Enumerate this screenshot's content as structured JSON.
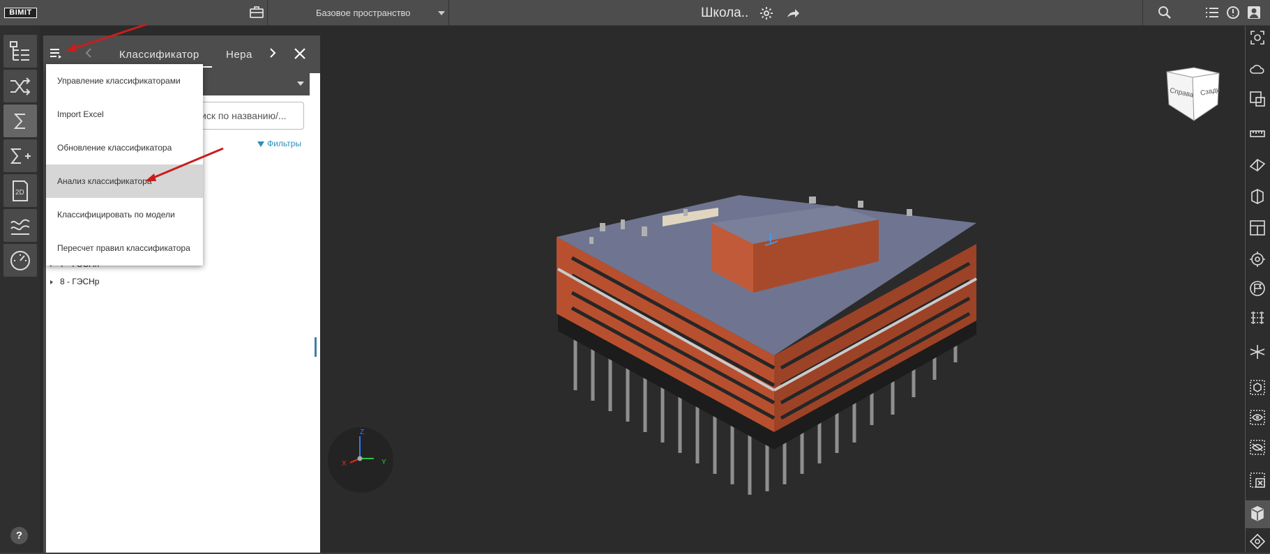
{
  "app": {
    "logo": "BIMIT"
  },
  "header": {
    "workspace": "Базовое пространство",
    "title": "Школа..",
    "icons": [
      "briefcase-icon",
      "chevron-down-icon",
      "gear-icon",
      "share-icon",
      "search-icon",
      "list-icon",
      "sync-icon",
      "account-icon"
    ]
  },
  "left_rail": {
    "items": [
      "tree-structure-icon",
      "shuffle-icon",
      "sigma-icon",
      "sigma-plus-icon",
      "2d-drawing-icon",
      "chart-lines-icon",
      "gauge-icon"
    ],
    "active": "sigma-icon",
    "help_label": "?"
  },
  "panel": {
    "tabs": [
      "Классификатор",
      "Нера"
    ],
    "active_tab": "Классификатор",
    "search_placeholder": "иск по названию/...",
    "filters_label": "Фильтры",
    "tree_items": [
      {
        "label": "7 - ГЭСНп"
      },
      {
        "label": "8 - ГЭСНр"
      }
    ]
  },
  "menu": {
    "items": [
      "Управление классификаторами",
      "Import Excel",
      "Обновление классификатора",
      "Анализ классификатора",
      "Классифицировать по модели",
      "Пересчет правил классификатора"
    ],
    "highlighted_index": 3
  },
  "viewport": {
    "view_cube_faces": [
      "Справа",
      "Сзади"
    ],
    "axes": {
      "x": "X",
      "y": "Y",
      "z": "Z"
    }
  },
  "right_rail": {
    "icons": [
      "fit-view-icon",
      "cloud-icon",
      "select-area-icon",
      "ruler-icon",
      "section-plane-icon",
      "section-box-icon",
      "floor-plan-icon",
      "target-icon",
      "flag-icon",
      "st-dimensions-icon",
      "explode-icon",
      "cube-select-icon",
      "eye-icon",
      "eye-off-icon",
      "box-x-icon",
      "solid-cube-icon",
      "navigation-icon"
    ]
  },
  "colors": {
    "accent": "#2a8fb8",
    "annotation_arrow": "#c81e1e",
    "brick": "#b8502f",
    "roof": "#6f7590"
  }
}
